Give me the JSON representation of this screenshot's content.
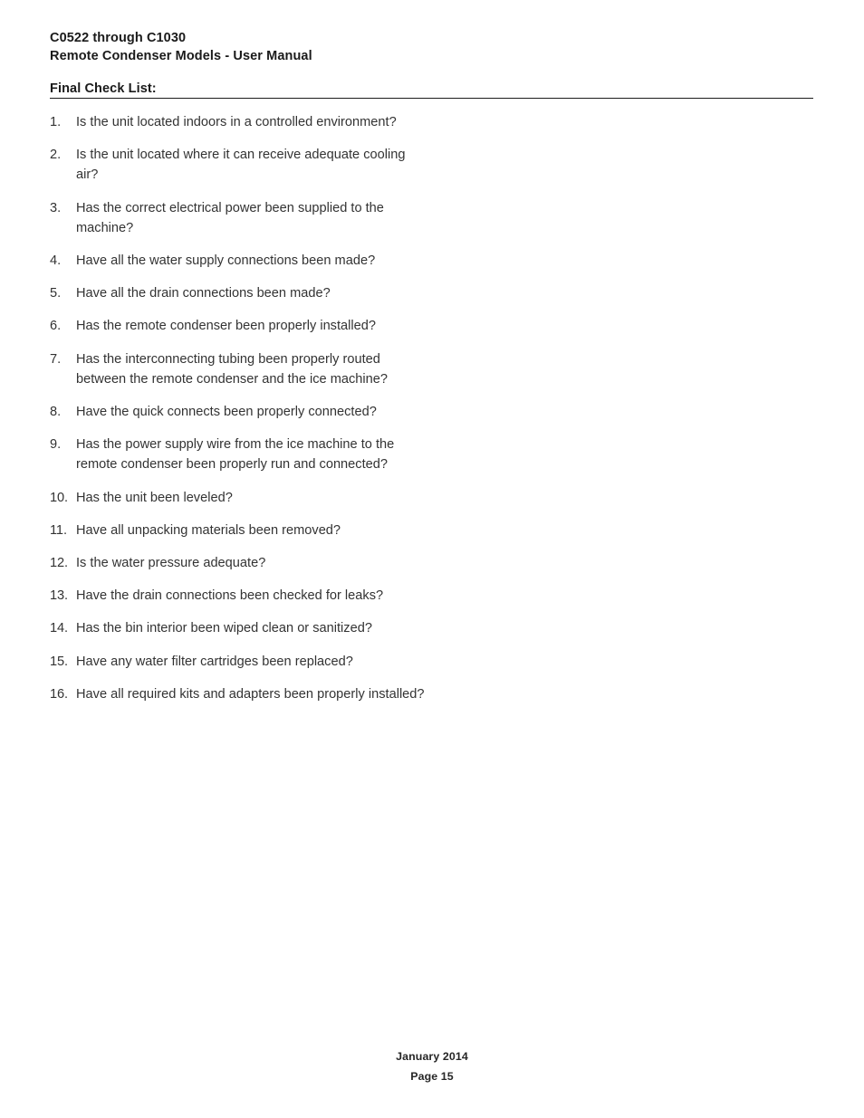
{
  "document": {
    "header": {
      "line1": "C0522 through C1030",
      "line2": "Remote Condenser Models - User Manual"
    },
    "section_title": "Final Check List:",
    "checklist": [
      {
        "number": "1.",
        "text": "Is the unit located indoors in a controlled environment?"
      },
      {
        "number": "2.",
        "text": "Is the unit located where it can receive adequate cooling air?"
      },
      {
        "number": "3.",
        "text": "Has the correct electrical power been supplied to the machine?"
      },
      {
        "number": "4.",
        "text": "Have all the water supply connections been made?"
      },
      {
        "number": "5.",
        "text": "Have all the drain connections been made?"
      },
      {
        "number": "6.",
        "text": "Has the remote condenser been properly installed?"
      },
      {
        "number": "7.",
        "text": "Has the interconnecting tubing been properly routed between the remote condenser and the ice machine?"
      },
      {
        "number": "8.",
        "text": "Have the quick connects been properly connected?"
      },
      {
        "number": "9.",
        "text": "Has the power supply wire from the ice machine to the remote condenser been properly run and connected?"
      },
      {
        "number": "10.",
        "text": "Has the unit been leveled?"
      },
      {
        "number": "11.",
        "text": "Have all unpacking materials been removed?"
      },
      {
        "number": "12.",
        "text": "Is the water pressure adequate?"
      },
      {
        "number": "13.",
        "text": "Have the drain connections been checked for leaks?"
      },
      {
        "number": "14.",
        "text": "Has the bin interior been wiped clean or sanitized?"
      },
      {
        "number": "15.",
        "text": "Have any water filter cartridges been replaced?"
      },
      {
        "number": "16.",
        "text": "Have all required kits and adapters been properly installed?"
      }
    ],
    "footer": {
      "date": "January 2014",
      "page": "Page 15"
    },
    "colors": {
      "background": "#ffffff",
      "body_text": "#333333",
      "heading_text": "#1a1a1a",
      "rule": "#1a1a1a"
    }
  }
}
